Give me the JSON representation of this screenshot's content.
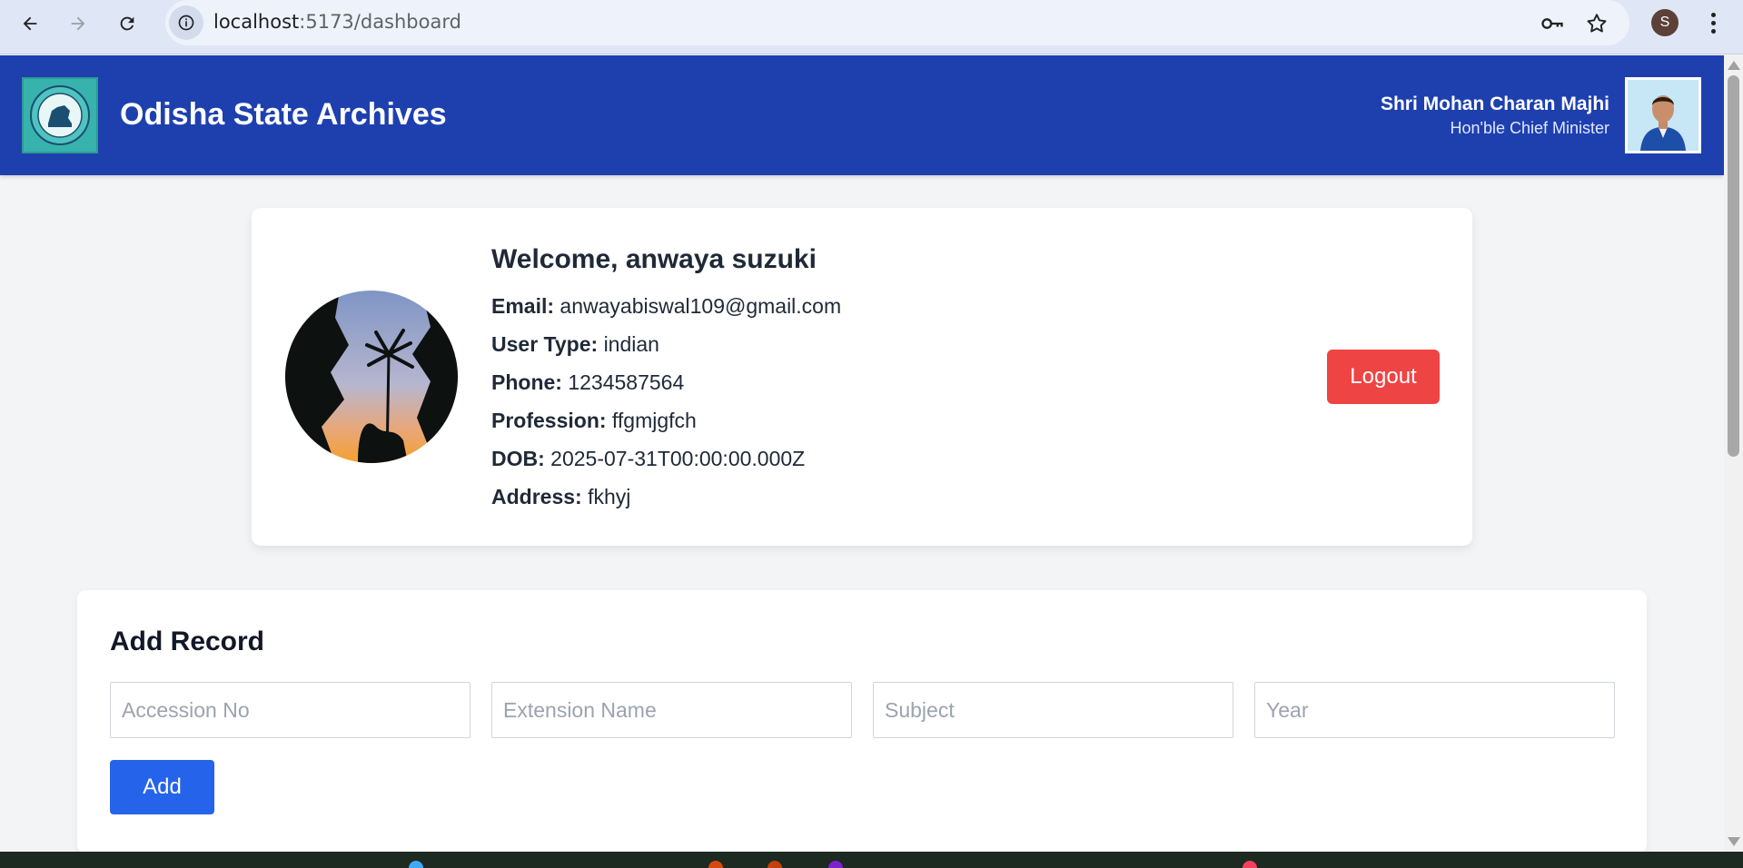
{
  "browser": {
    "url_host": "localhost",
    "url_path": ":5173/dashboard",
    "profile_initial": "S"
  },
  "header": {
    "site_title": "Odisha State Archives",
    "cm_name": "Shri Mohan Charan Majhi",
    "cm_role": "Hon'ble Chief Minister",
    "bg_color": "#1e40af"
  },
  "profile": {
    "welcome": "Welcome, anwaya suzuki",
    "fields": [
      {
        "label": "Email:",
        "value": "anwayabiswal109@gmail.com"
      },
      {
        "label": "User Type:",
        "value": "indian"
      },
      {
        "label": "Phone:",
        "value": "1234587564"
      },
      {
        "label": "Profession:",
        "value": "ffgmjgfch"
      },
      {
        "label": "DOB:",
        "value": "2025-07-31T00:00:00.000Z"
      },
      {
        "label": "Address:",
        "value": "fkhyj"
      }
    ],
    "logout_label": "Logout",
    "logout_color": "#ef4444"
  },
  "add_record": {
    "title": "Add Record",
    "inputs": [
      {
        "placeholder": "Accession No",
        "value": ""
      },
      {
        "placeholder": "Extension Name",
        "value": ""
      },
      {
        "placeholder": "Subject",
        "value": ""
      },
      {
        "placeholder": "Year",
        "value": ""
      }
    ],
    "add_label": "Add",
    "add_color": "#2563eb"
  }
}
